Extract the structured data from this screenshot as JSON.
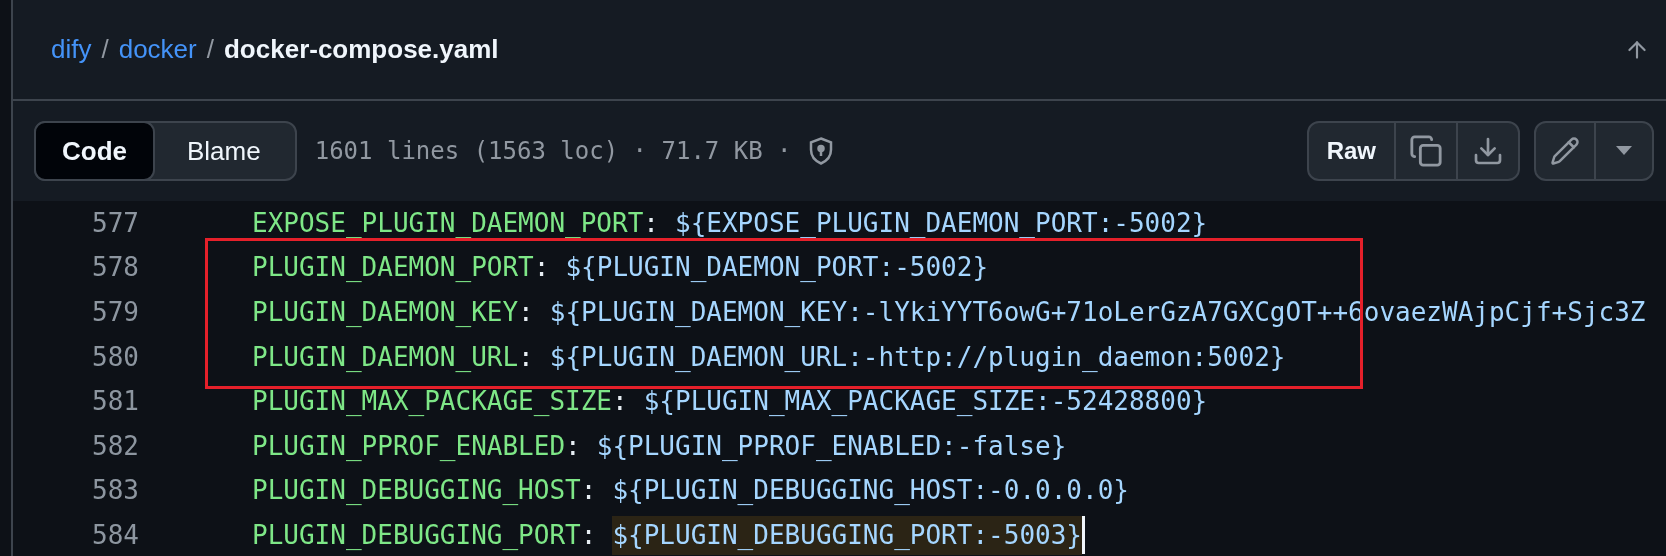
{
  "breadcrumb": [
    {
      "kind": "link",
      "label": "dify"
    },
    {
      "kind": "separator",
      "label": "/"
    },
    {
      "kind": "link",
      "label": "docker"
    },
    {
      "kind": "separator",
      "label": "/"
    },
    {
      "kind": "current",
      "label": "docker-compose.yaml"
    }
  ],
  "view_tabs": [
    {
      "label": "Code",
      "selected": true
    },
    {
      "label": "Blame",
      "selected": false
    }
  ],
  "file_info": "1601 lines (1563 loc) · 71.7 KB ·",
  "raw_button": "Raw",
  "lines": [
    {
      "number": "577",
      "key": "EXPOSE_PLUGIN_DAEMON_PORT",
      "colon": ":",
      "value": "${EXPOSE_PLUGIN_DAEMON_PORT:-5002}",
      "in_box": false,
      "marked": false,
      "cursor": false
    },
    {
      "number": "578",
      "key": "PLUGIN_DAEMON_PORT",
      "colon": ":",
      "value": "${PLUGIN_DAEMON_PORT:-5002}",
      "in_box": true,
      "marked": false,
      "cursor": false
    },
    {
      "number": "579",
      "key": "PLUGIN_DAEMON_KEY",
      "colon": ":",
      "value": "${PLUGIN_DAEMON_KEY:-lYkiYYT6owG+71oLerGzA7GXCgOT++6ovaezWAjpCjf+Sjc3Z",
      "in_box": true,
      "marked": false,
      "cursor": false
    },
    {
      "number": "580",
      "key": "PLUGIN_DAEMON_URL",
      "colon": ":",
      "value": "${PLUGIN_DAEMON_URL:-http://plugin_daemon:5002}",
      "in_box": true,
      "marked": false,
      "cursor": false
    },
    {
      "number": "581",
      "key": "PLUGIN_MAX_PACKAGE_SIZE",
      "colon": ":",
      "value": "${PLUGIN_MAX_PACKAGE_SIZE:-52428800}",
      "in_box": false,
      "marked": false,
      "cursor": false
    },
    {
      "number": "582",
      "key": "PLUGIN_PPROF_ENABLED",
      "colon": ":",
      "value": "${PLUGIN_PPROF_ENABLED:-false}",
      "in_box": false,
      "marked": false,
      "cursor": false
    },
    {
      "number": "583",
      "key": "PLUGIN_DEBUGGING_HOST",
      "colon": ":",
      "value": "${PLUGIN_DEBUGGING_HOST:-0.0.0.0}",
      "in_box": false,
      "marked": false,
      "cursor": false
    },
    {
      "number": "584",
      "key": "PLUGIN_DEBUGGING_PORT",
      "colon": ":",
      "value": "${PLUGIN_DEBUGGING_PORT:-5003}",
      "in_box": false,
      "marked": true,
      "cursor": true
    }
  ]
}
